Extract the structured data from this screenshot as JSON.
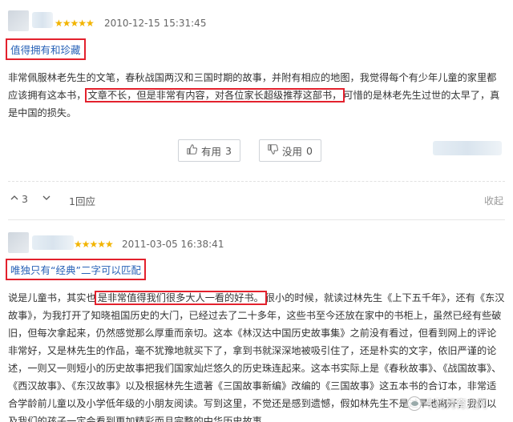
{
  "review1": {
    "stars": "★★★★★",
    "date": "2010-12-15 15:31:45",
    "title": "值得拥有和珍藏",
    "body_before": "非常佩服林老先生的文笔，春秋战国两汉和三国时期的故事，并附有相应的地图，我觉得每个有少年儿童的家里都应该拥有这本书，",
    "body_highlight": "文章不长，但是非常有内容，对各位家长超级推荐这部书，",
    "body_after": "可惜的是林老先生过世的太早了，真是中国的损失。",
    "useful_label": "有用",
    "useful_count": "3",
    "useless_label": "没用",
    "useless_count": "0",
    "like_count": "3",
    "reply_label": "1回应",
    "collapse_label": "收起"
  },
  "review2": {
    "stars": "★★★★★",
    "date": "2011-03-05 16:38:41",
    "title": "唯独只有“经典”二字可以匹配",
    "body_before": "说是儿童书，其实也",
    "body_highlight": "是非常值得我们很多大人一看的好书。",
    "body_after": "很小的时候，就读过林先生《上下五千年》，还有《东汉故事》，为我打开了知晓祖国历史的大门，已经过去了二十多年，这些书至今还放在家中的书柜上，虽然已经有些破旧，但每次拿起来，仍然感觉那么厚重而亲切。这本《林汉达中国历史故事集》之前没有看过，但看到网上的评论非常好，又是林先生的作品，毫不犹豫地就买下了，拿到书就深深地被吸引住了，还是朴实的文字，依旧严谨的论述，一则又一则短小的历史故事把我们国家灿烂悠久的历史珠连起来。这本书实际上是《春秋故事》、《战国故事》、《西汉故事》、《东汉故事》以及根据林先生遗著《三国故事新编》改编的《三国故事》这五本书的合订本，非常适合学龄前儿童以及小学低年级的小朋友阅读。写到这里，不觉还是感到遗憾，假如林先生不是过早地离开，我们以及我们的孩子一定会看到更加精彩而且完整的中华历史故事。"
  },
  "watermark": "牛妈妈育儿网",
  "colors": {
    "highlight_border": "#e3212d",
    "title_text": "#2a63b8",
    "star": "#f2b400"
  }
}
